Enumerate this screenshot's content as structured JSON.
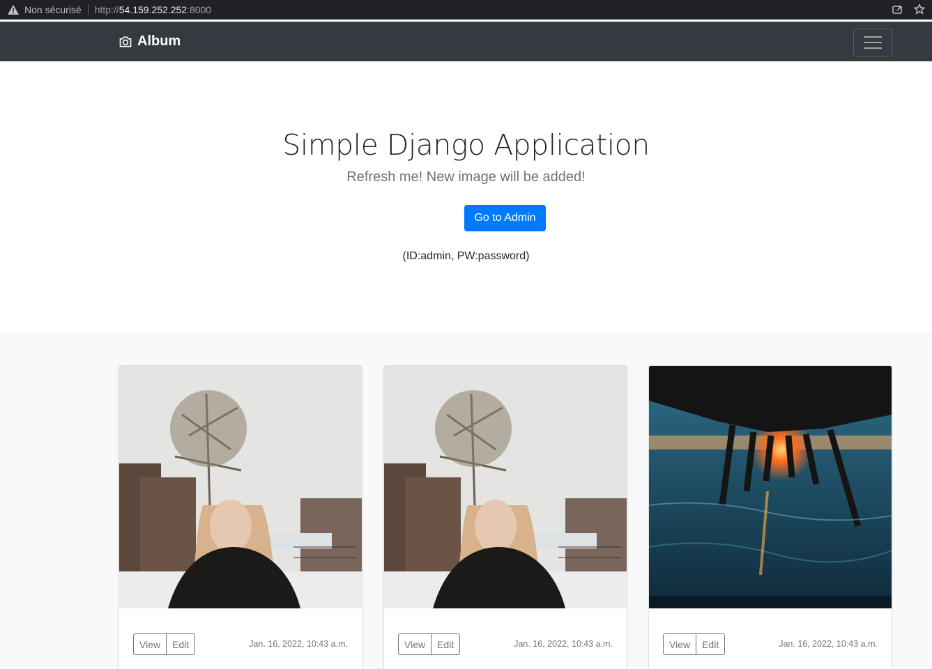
{
  "browser": {
    "security_label": "Non sécurisé",
    "url_scheme": "http://",
    "url_host": "54.159.252.252",
    "url_port": ":8000",
    "icons": [
      "warning-icon",
      "share-icon",
      "star-icon"
    ]
  },
  "navbar": {
    "brand": "Album",
    "brand_icon": "camera-icon",
    "toggler_icon": "hamburger-icon"
  },
  "hero": {
    "title": "Simple Django Application",
    "lead": "Refresh me! New image will be added!",
    "button_label": "Go to Admin",
    "credentials": "(ID:admin, PW:password)",
    "button_color": "#007bff"
  },
  "cards": [
    {
      "image": "woman-in-snow-photo",
      "view_label": "View",
      "edit_label": "Edit",
      "date": "Jan. 16, 2022, 10:43 a.m."
    },
    {
      "image": "woman-in-snow-photo",
      "view_label": "View",
      "edit_label": "Edit",
      "date": "Jan. 16, 2022, 10:43 a.m."
    },
    {
      "image": "pier-sunset-photo",
      "view_label": "View",
      "edit_label": "Edit",
      "date": "Jan. 16, 2022, 10:43 a.m."
    }
  ]
}
